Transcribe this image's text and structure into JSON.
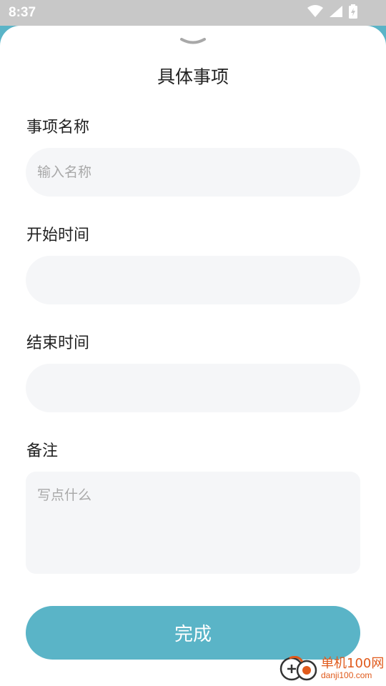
{
  "status_bar": {
    "time": "8:37",
    "icons": [
      "wifi-icon",
      "signal-icon",
      "battery-icon"
    ]
  },
  "sheet": {
    "handle_icon": "chevron-down-icon",
    "title": "具体事项"
  },
  "form": {
    "name": {
      "label": "事项名称",
      "placeholder": "输入名称",
      "value": ""
    },
    "start_time": {
      "label": "开始时间",
      "value": ""
    },
    "end_time": {
      "label": "结束时间",
      "value": ""
    },
    "notes": {
      "label": "备注",
      "placeholder": "写点什么",
      "value": ""
    }
  },
  "done_button_label": "完成",
  "watermark": {
    "brand": "单机100网",
    "url": "danji100.com"
  },
  "colors": {
    "accent": "#5ab4c7",
    "field_bg": "#f5f6f8",
    "status_bar": "#c8c8c8",
    "watermark": "#e05a1b"
  }
}
